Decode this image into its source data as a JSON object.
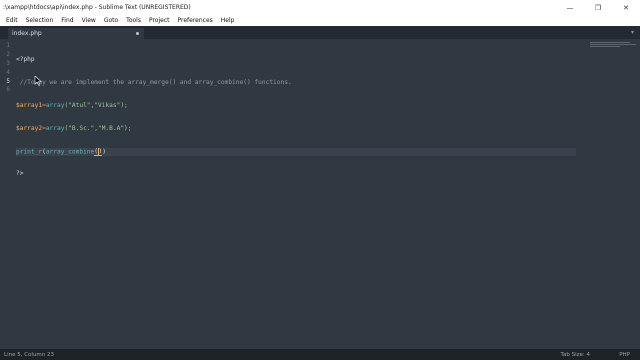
{
  "window": {
    "title": ":\\xampp\\htdocs\\api\\index.php - Sublime Text (UNREGISTERED)",
    "controls": {
      "minimize": "—",
      "restore": "❐",
      "close": "✕"
    }
  },
  "menu": [
    "Edit",
    "Selection",
    "Find",
    "View",
    "Goto",
    "Tools",
    "Project",
    "Preferences",
    "Help"
  ],
  "tabs": [
    {
      "label": "index.php",
      "modified": true
    }
  ],
  "tab_dropdown": "▾",
  "editor": {
    "line_numbers": [
      "1",
      "2",
      "3",
      "4",
      "5",
      "6"
    ],
    "current_line": 5,
    "lines": {
      "l1": "<?php",
      "l2": " //Today we are implement the array_merge() and array_combine() functions.",
      "l3_var": "$array1",
      "l3_op": "=",
      "l3_fn": "array",
      "l3_args": "(\"Atul\",\"Vikas\");",
      "l4_var": "$array2",
      "l4_op": "=",
      "l4_fn": "array",
      "l4_args": "(\"B.Sc.\",\"M.B.A\");",
      "l5_fn": "print_r",
      "l5_open": "(",
      "l5_fn2": "array_combine",
      "l5_inner": "(",
      "l5_close": ")",
      "l5_tail": ")",
      "l6": "?>"
    }
  },
  "status": {
    "position": "Line 5, Column 23",
    "tab_size": "Tab Size: 4",
    "syntax": "PHP"
  },
  "colors": {
    "background": "#303841",
    "variable": "#f9ae58",
    "function": "#5fb4b4",
    "string": "#99c794",
    "operator": "#f97b58",
    "comment": "#8f979e"
  }
}
